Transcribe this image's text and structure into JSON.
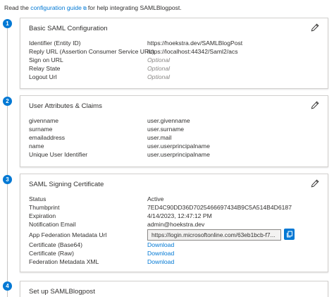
{
  "intro": {
    "prefix": "Read the",
    "link": "configuration guide",
    "suffix": "for help integrating SAMLBlogpost."
  },
  "icons": {
    "external": "external-link-icon",
    "edit": "pencil-icon",
    "copy": "copy-icon"
  },
  "colors": {
    "accent": "#0078d4",
    "border": "#d2d0ce",
    "optional": "#8a8886"
  },
  "sections": [
    {
      "step": "1",
      "title": "Basic SAML Configuration",
      "rows": [
        {
          "label": "Identifier (Entity ID)",
          "value": "https://hoekstra.dev/SAMLBlogPost"
        },
        {
          "label": "Reply URL (Assertion Consumer Service URL)",
          "value": "https://localhost:44342/Saml2/acs"
        },
        {
          "label": "Sign on URL",
          "value": "Optional"
        },
        {
          "label": "Relay State",
          "value": "Optional"
        },
        {
          "label": "Logout Url",
          "value": "Optional"
        }
      ]
    },
    {
      "step": "2",
      "title": "User Attributes & Claims",
      "rows": [
        {
          "label": "givenname",
          "value": "user.givenname"
        },
        {
          "label": "surname",
          "value": "user.surname"
        },
        {
          "label": "emailaddress",
          "value": "user.mail"
        },
        {
          "label": "name",
          "value": "user.userprincipalname"
        },
        {
          "label": "Unique User Identifier",
          "value": "user.userprincipalname"
        }
      ]
    },
    {
      "step": "3",
      "title": "SAML Signing Certificate",
      "rows": [
        {
          "label": "Status",
          "value": "Active"
        },
        {
          "label": "Thumbprint",
          "value": "7ED4C90DD36D7025466697434B9C5A514B4D6187"
        },
        {
          "label": "Expiration",
          "value": "4/14/2023, 12:47:12 PM"
        },
        {
          "label": "Notification Email",
          "value": "admin@hoekstra.dev"
        },
        {
          "label": "App Federation Metadata Url",
          "value": "https://login.microsoftonline.com/63eb1bcb-f7..."
        },
        {
          "label": "Certificate (Base64)",
          "value": "Download"
        },
        {
          "label": "Certificate (Raw)",
          "value": "Download"
        },
        {
          "label": "Federation Metadata XML",
          "value": "Download"
        }
      ]
    },
    {
      "step": "4",
      "title": "Set up SAMLBlogpost",
      "rows": []
    }
  ]
}
